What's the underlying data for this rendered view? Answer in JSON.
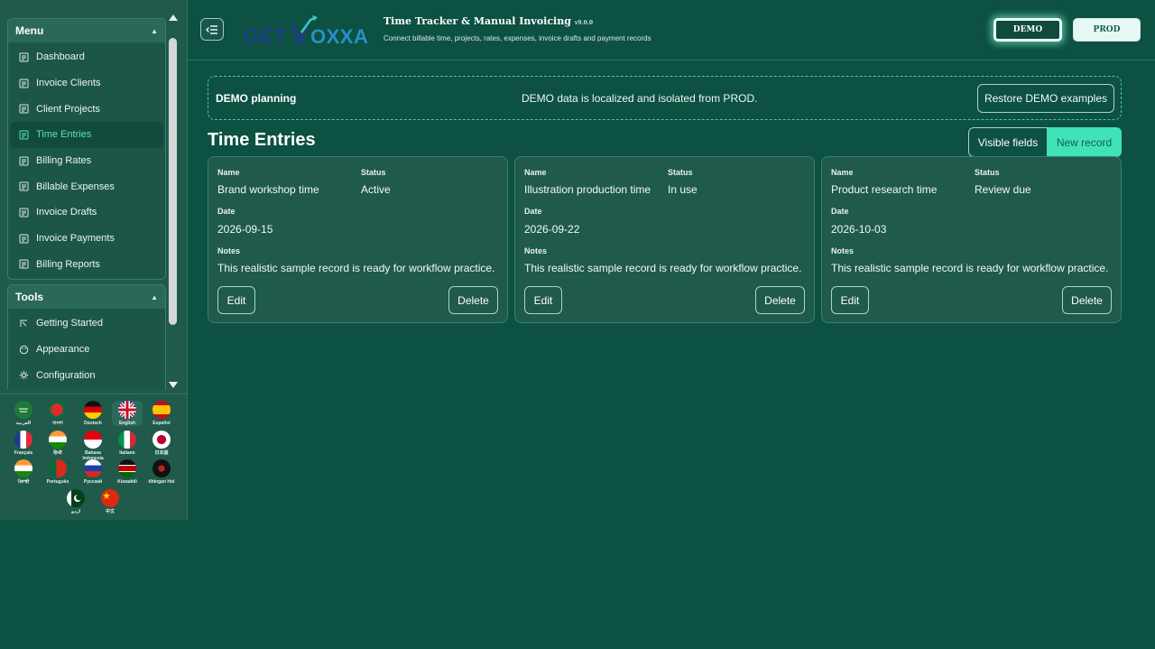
{
  "sidebar": {
    "menu_title": "Menu",
    "menu_items": [
      {
        "label": "Dashboard",
        "active": false
      },
      {
        "label": "Invoice Clients",
        "active": false
      },
      {
        "label": "Client Projects",
        "active": false
      },
      {
        "label": "Time Entries",
        "active": true
      },
      {
        "label": "Billing Rates",
        "active": false
      },
      {
        "label": "Billable Expenses",
        "active": false
      },
      {
        "label": "Invoice Drafts",
        "active": false
      },
      {
        "label": "Invoice Payments",
        "active": false
      },
      {
        "label": "Billing Reports",
        "active": false
      }
    ],
    "tools_title": "Tools",
    "tools_items": [
      {
        "label": "Getting Started",
        "icon": "start-icon"
      },
      {
        "label": "Appearance",
        "icon": "palette-icon"
      },
      {
        "label": "Configuration",
        "icon": "gear-icon"
      }
    ],
    "languages": [
      {
        "name": "العربية",
        "flag": "saudi-arabia"
      },
      {
        "name": "বাংলা",
        "flag": "bangladesh"
      },
      {
        "name": "Deutsch",
        "flag": "germany"
      },
      {
        "name": "English",
        "flag": "united-kingdom",
        "selected": true
      },
      {
        "name": "Español",
        "flag": "spain"
      },
      {
        "name": "Français",
        "flag": "france"
      },
      {
        "name": "हिन्दी",
        "flag": "india"
      },
      {
        "name": "Bahasa Indonesia",
        "flag": "indonesia"
      },
      {
        "name": "Italiano",
        "flag": "italy"
      },
      {
        "name": "日本語",
        "flag": "japan"
      },
      {
        "name": "ਪੰਜਾਬੀ",
        "flag": "india"
      },
      {
        "name": "Português",
        "flag": "portugal"
      },
      {
        "name": "Русский",
        "flag": "russia"
      },
      {
        "name": "Kiswahili",
        "flag": "kenya"
      },
      {
        "name": "tlhIngan Hol",
        "flag": "klingon"
      },
      {
        "name": "اردو",
        "flag": "pakistan"
      },
      {
        "name": "中文",
        "flag": "china"
      }
    ]
  },
  "header": {
    "logo_text": "GETVOXXA",
    "title": "Time Tracker & Manual Invoicing",
    "version": "v9.0.0",
    "subtitle": "Connect billable time, projects, rates, expenses, invoice drafts and payment records",
    "demo_label": "DEMO",
    "prod_label": "PROD"
  },
  "banner": {
    "title": "DEMO planning",
    "message": "DEMO data is localized and isolated from PROD.",
    "restore_label": "Restore DEMO examples"
  },
  "main": {
    "title": "Time Entries",
    "visible_fields_label": "Visible fields",
    "new_record_label": "New record",
    "field_labels": {
      "name": "Name",
      "status": "Status",
      "date": "Date",
      "notes": "Notes"
    },
    "edit_label": "Edit",
    "delete_label": "Delete",
    "records": [
      {
        "name": "Brand workshop time",
        "status": "Active",
        "date": "2026-09-15",
        "notes": "This realistic sample record is ready for workflow practice."
      },
      {
        "name": "Illustration production time",
        "status": "In use",
        "date": "2026-09-22",
        "notes": "This realistic sample record is ready for workflow practice."
      },
      {
        "name": "Product research time",
        "status": "Review due",
        "date": "2026-10-03",
        "notes": "This realistic sample record is ready for workflow practice."
      }
    ]
  },
  "colors": {
    "background": "#0c5142",
    "accent": "#3fe3b7",
    "active_nav": "#55e3bd"
  }
}
